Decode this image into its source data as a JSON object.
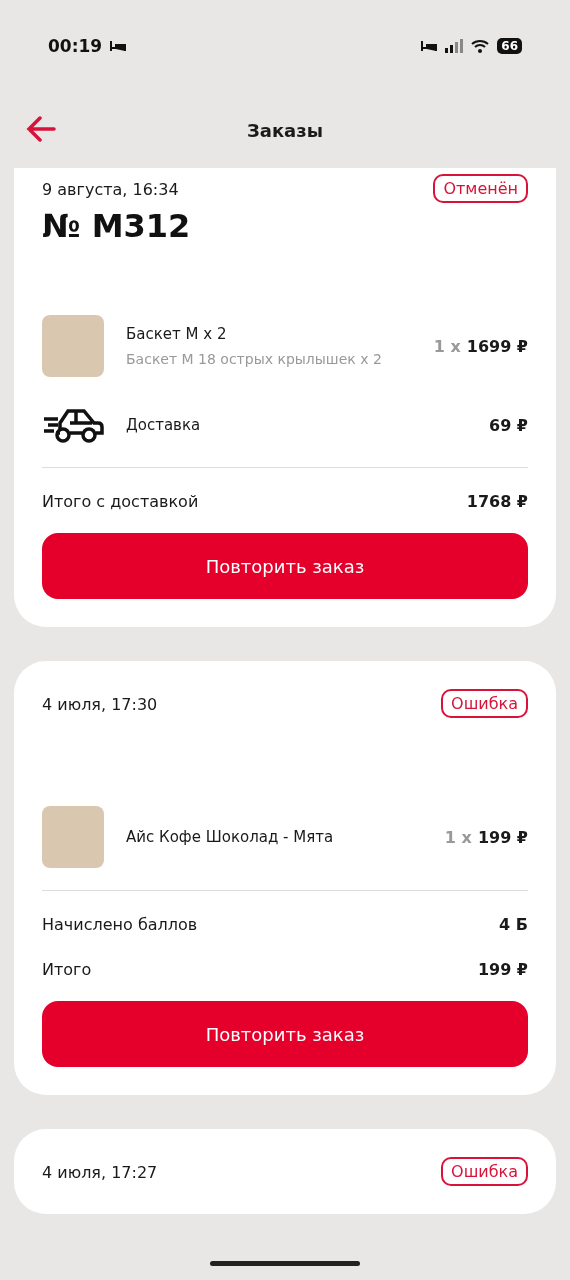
{
  "status_bar": {
    "time": "00:19",
    "battery": "66"
  },
  "header": {
    "title": "Заказы"
  },
  "orders": [
    {
      "date": "9 августа, 16:34",
      "number": "№ M312",
      "status": "Отменён",
      "items": [
        {
          "kind": "product",
          "name": "Баскет M x 2",
          "description": "Баскет M 18 острых крылышек x 2",
          "qty": "1 x",
          "price": "1699 ₽"
        },
        {
          "kind": "delivery",
          "name": "Доставка",
          "price": "69 ₽"
        }
      ],
      "totals": [
        {
          "label": "Итого с доставкой",
          "value": "1768 ₽"
        }
      ],
      "button": "Повторить заказ"
    },
    {
      "date": "4 июля, 17:30",
      "status": "Ошибка",
      "items": [
        {
          "kind": "product",
          "name": "Айс Кофе Шоколад - Мята",
          "qty": "1 x",
          "price": "199 ₽"
        }
      ],
      "totals": [
        {
          "label": "Начислено баллов",
          "value": "4 Б"
        },
        {
          "label": "Итого",
          "value": "199 ₽"
        }
      ],
      "button": "Повторить заказ"
    },
    {
      "date": "4 июля, 17:27",
      "status": "Ошибка"
    }
  ]
}
